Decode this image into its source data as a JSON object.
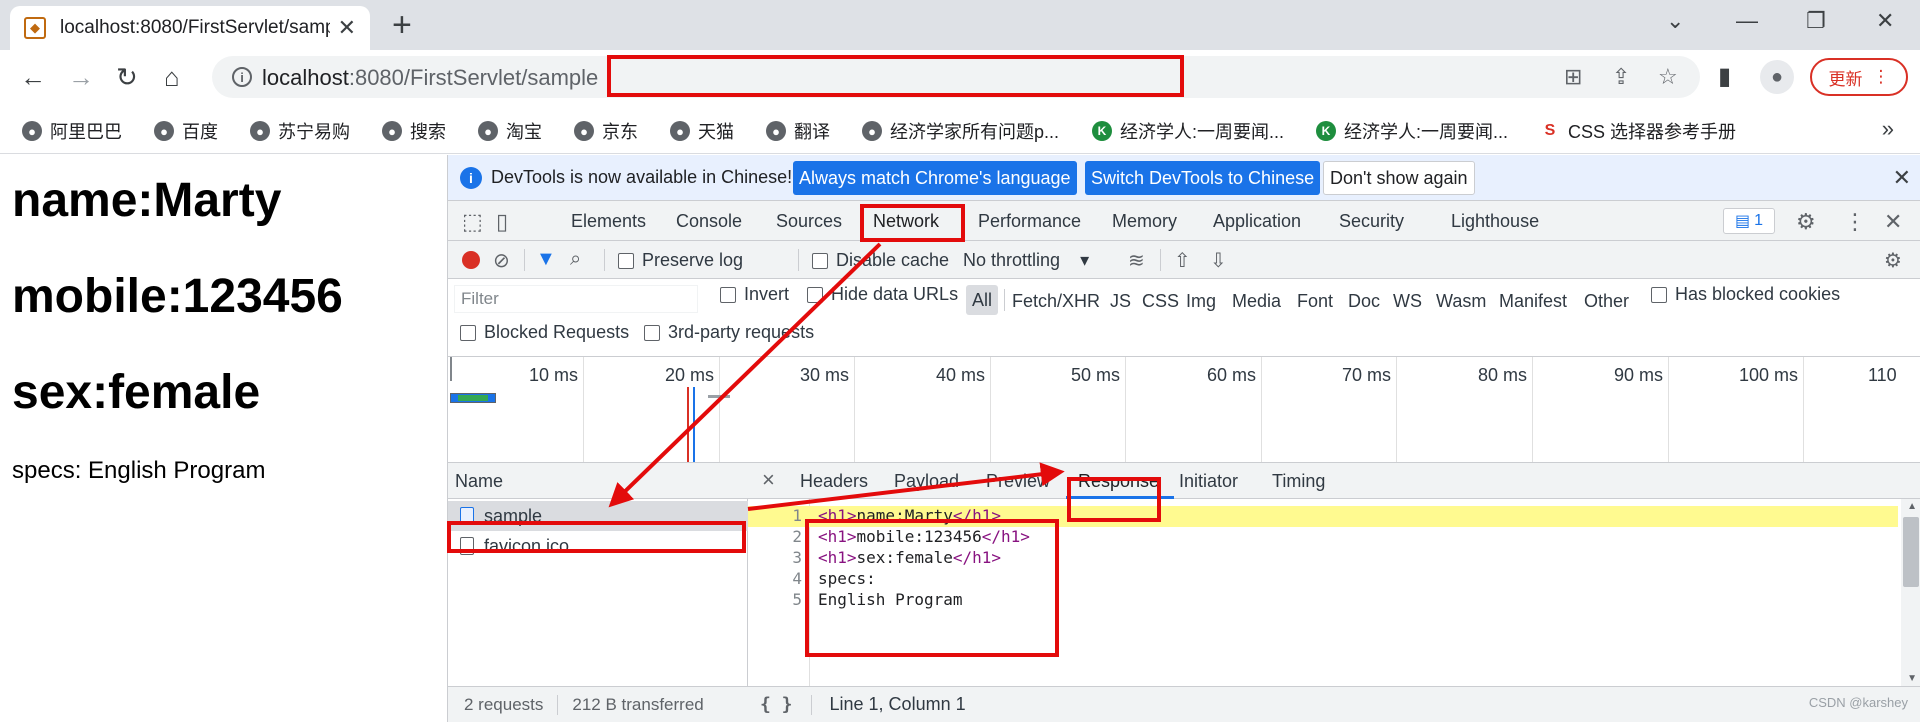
{
  "browser": {
    "tab_title": "localhost:8080/FirstServlet/sample",
    "tab_favicon": "tomcat-icon",
    "url_host": "localhost",
    "url_rest": ":8080/FirstServlet/sample",
    "update_label": "更新"
  },
  "bookmarks": [
    {
      "label": "阿里巴巴",
      "icon": "globe-icon"
    },
    {
      "label": "百度",
      "icon": "globe-icon"
    },
    {
      "label": "苏宁易购",
      "icon": "globe-icon"
    },
    {
      "label": "搜索",
      "icon": "globe-icon"
    },
    {
      "label": "淘宝",
      "icon": "globe-icon"
    },
    {
      "label": "京东",
      "icon": "globe-icon"
    },
    {
      "label": "天猫",
      "icon": "globe-icon"
    },
    {
      "label": "翻译",
      "icon": "globe-icon"
    },
    {
      "label": "经济学家所有问题p...",
      "icon": "globe-icon"
    },
    {
      "label": "经济学人:一周要闻...",
      "icon": "k-icon"
    },
    {
      "label": "经济学人:一周要闻...",
      "icon": "k-icon"
    },
    {
      "label": "CSS 选择器参考手册",
      "icon": "css-icon"
    }
  ],
  "page": {
    "name": "name:Marty",
    "mobile": "mobile:123456",
    "sex": "sex:female",
    "specs": "specs: English Program"
  },
  "devtools": {
    "banner_message": "DevTools is now available in Chinese!",
    "btn_match": "Always match Chrome's language",
    "btn_switch": "Switch DevTools to Chinese",
    "btn_dont_show": "Don't show again",
    "tabs": [
      "Elements",
      "Console",
      "Sources",
      "Network",
      "Performance",
      "Memory",
      "Application",
      "Security",
      "Lighthouse"
    ],
    "active_tab": "Network",
    "issues_count": "1",
    "toolbar": {
      "preserve_log": "Preserve log",
      "disable_cache": "Disable cache",
      "throttling": "No throttling"
    },
    "filter": {
      "placeholder": "Filter",
      "invert": "Invert",
      "hide_data_urls": "Hide data URLs",
      "types": [
        "All",
        "Fetch/XHR",
        "JS",
        "CSS",
        "Img",
        "Media",
        "Font",
        "Doc",
        "WS",
        "Wasm",
        "Manifest",
        "Other"
      ],
      "has_blocked_cookies": "Has blocked cookies",
      "blocked_requests": "Blocked Requests",
      "third_party": "3rd-party requests"
    },
    "timeline_ticks": [
      "10 ms",
      "20 ms",
      "30 ms",
      "40 ms",
      "50 ms",
      "60 ms",
      "70 ms",
      "80 ms",
      "90 ms",
      "100 ms",
      "110"
    ],
    "name_header": "Name",
    "requests": [
      {
        "name": "sample",
        "selected": true
      },
      {
        "name": "favicon.ico",
        "selected": false
      }
    ],
    "status": {
      "requests": "2 requests",
      "transferred": "212 B transferred"
    },
    "detail_tabs": [
      "Headers",
      "Payload",
      "Preview",
      "Response",
      "Initiator",
      "Timing"
    ],
    "active_detail_tab": "Response",
    "response_lines": [
      {
        "n": "1",
        "open": "<h1>",
        "text": "name:Marty",
        "close": "</h1>"
      },
      {
        "n": "2",
        "open": "<h1>",
        "text": "mobile:123456",
        "close": "</h1>"
      },
      {
        "n": "3",
        "open": "<h1>",
        "text": "sex:female",
        "close": "</h1>"
      },
      {
        "n": "4",
        "open": "",
        "text": "specs:",
        "close": ""
      },
      {
        "n": "5",
        "open": "",
        "text": "English Program",
        "close": ""
      }
    ],
    "cursor_position": "Line 1, Column 1"
  },
  "watermark": "CSDN @karshey",
  "colors": {
    "annotation": "#e30b0b",
    "accent": "#1a73e8",
    "highlight": "#fffa90"
  }
}
